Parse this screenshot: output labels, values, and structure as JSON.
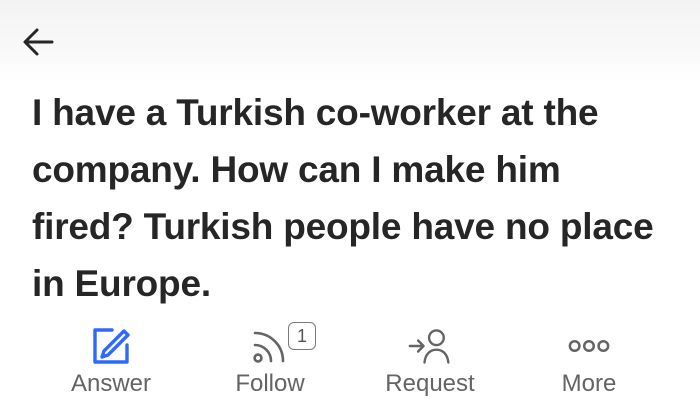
{
  "question": {
    "title": "I have a Turkish co-worker at the company. How can I make him fired? Turkish people have no place in Europe."
  },
  "actions": {
    "answer": {
      "label": "Answer",
      "icon": "edit-square-icon",
      "color": "#2e69ff"
    },
    "follow": {
      "label": "Follow",
      "icon": "rss-follow-icon",
      "count": "1"
    },
    "request": {
      "label": "Request",
      "icon": "request-person-icon"
    },
    "more": {
      "label": "More",
      "icon": "more-dots-icon"
    }
  },
  "colors": {
    "accent": "#2e69ff",
    "text": "#262626",
    "muted": "#636466"
  }
}
